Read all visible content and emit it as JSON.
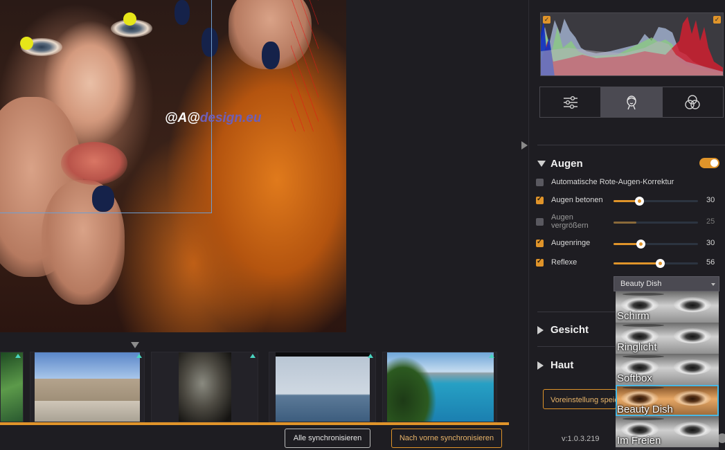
{
  "photo": {
    "watermark_part1": "@A@",
    "watermark_part2": "design.eu"
  },
  "filmstrip": {
    "progress": 1.0,
    "thumbnails": [
      {
        "name": "forest-thumb"
      },
      {
        "name": "palace-thumb"
      },
      {
        "name": "texture-thumb"
      },
      {
        "name": "sailboat-thumb"
      },
      {
        "name": "coast-thumb"
      }
    ]
  },
  "buttons": {
    "sync_all": "Alle synchronisieren",
    "sync_forward": "Nach vorne synchronisieren"
  },
  "mode_tabs": [
    {
      "icon": "sliders-icon",
      "active": false
    },
    {
      "icon": "face-icon",
      "active": true
    },
    {
      "icon": "color-circles-icon",
      "active": false
    }
  ],
  "eyes": {
    "title": "Augen",
    "enabled": true,
    "options": [
      {
        "label": "Automatische Rote-Augen-Korrektur",
        "checked": false
      },
      {
        "label": "Augen betonen",
        "checked": true,
        "value": "30",
        "level": 0.3
      },
      {
        "label": "Augen vergrößern",
        "checked": false,
        "value": "25",
        "level": 0.27
      },
      {
        "label": "Augenringe",
        "checked": true,
        "value": "30",
        "level": 0.32
      },
      {
        "label": "Reflexe",
        "checked": true,
        "value": "56",
        "level": 0.55
      }
    ]
  },
  "preset_select": {
    "value": "Beauty Dish",
    "options": [
      "Schirm",
      "Ringlicht",
      "Softbox",
      "Beauty Dish",
      "Im Freien"
    ],
    "selected_index": 3
  },
  "sections": {
    "face": "Gesicht",
    "skin": "Haut"
  },
  "preset_save_label": "Voreinstellung speichern",
  "version": "v:1.0.3.219",
  "colors": {
    "accent": "#e0942a",
    "selection": "#49b9e6"
  }
}
